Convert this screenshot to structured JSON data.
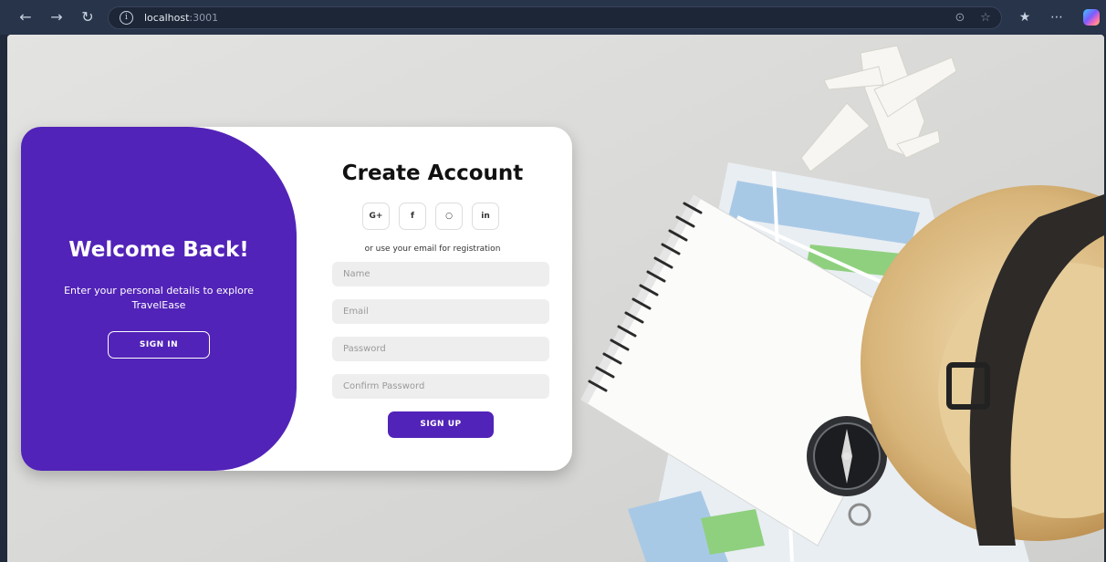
{
  "browser": {
    "url_host": "localhost",
    "url_port": ":3001",
    "icons": [
      "back-arrow-icon",
      "forward-arrow-icon",
      "reload-icon",
      "site-info-icon",
      "reader-icon",
      "favorite-star-icon",
      "favorites-icon",
      "more-icon",
      "copilot-icon"
    ]
  },
  "welcome": {
    "title": "Welcome Back!",
    "text": "Enter your personal details to explore TravelEase",
    "signin_label": "SIGN IN"
  },
  "signup": {
    "title": "Create Account",
    "social": [
      "G+",
      "f",
      "○",
      "in"
    ],
    "social_icons": [
      "google-plus-icon",
      "facebook-icon",
      "github-icon",
      "linkedin-icon"
    ],
    "subtitle": "or use your email for registration",
    "fields": {
      "name_placeholder": "Name",
      "email_placeholder": "Email",
      "password_placeholder": "Password",
      "confirm_placeholder": "Confirm Password"
    },
    "button_label": "SIGN UP"
  },
  "colors": {
    "accent": "#5223b8",
    "chrome": "#27344a",
    "card": "#ffffff"
  }
}
